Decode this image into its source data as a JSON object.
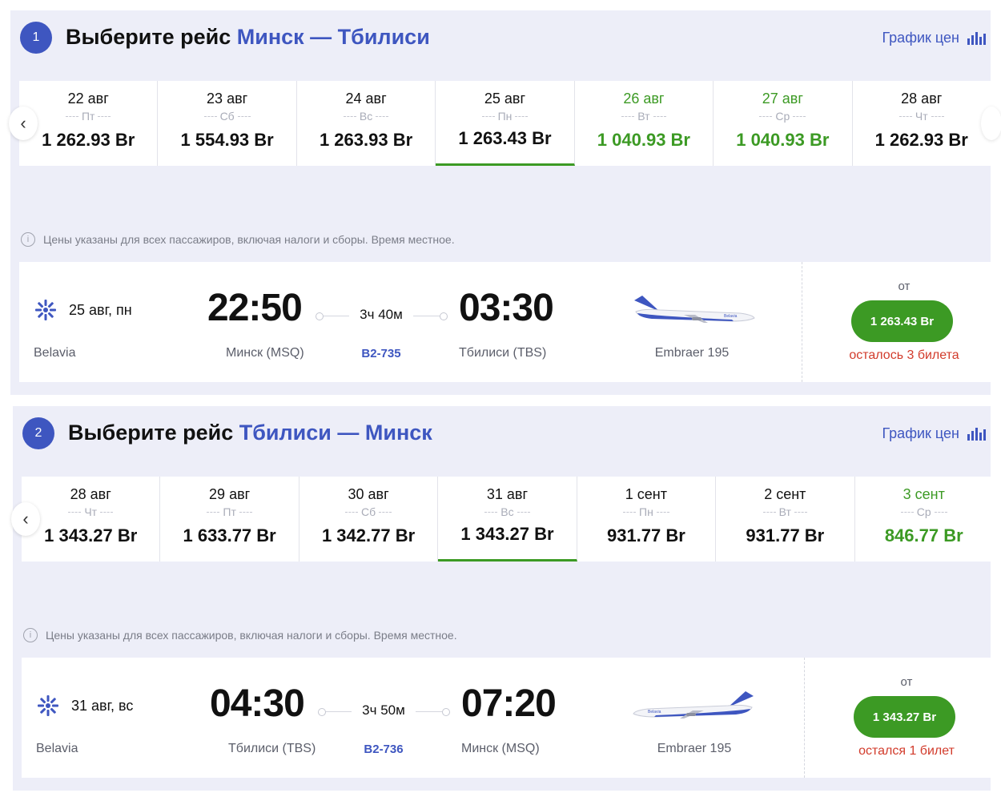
{
  "sections": [
    {
      "step": "1",
      "title_prefix": "Выберите рейс",
      "route": "Минск — Тбилиси",
      "chart_link": "График цен",
      "dates": [
        {
          "date": "22 авг",
          "weekday": "Пт",
          "price": "1 262.93 Br"
        },
        {
          "date": "23 авг",
          "weekday": "Сб",
          "price": "1 554.93 Br"
        },
        {
          "date": "24 авг",
          "weekday": "Вс",
          "price": "1 263.93 Br"
        },
        {
          "date": "25 авг",
          "weekday": "Пн",
          "price": "1 263.43 Br"
        },
        {
          "date": "26 авг",
          "weekday": "Вт",
          "price": "1 040.93 Br"
        },
        {
          "date": "27 авг",
          "weekday": "Ср",
          "price": "1 040.93 Br"
        },
        {
          "date": "28 авг",
          "weekday": "Чт",
          "price": "1 262.93 Br"
        }
      ],
      "note": "Цены указаны для всех пассажиров, включая налоги и сборы. Время местное.",
      "flight": {
        "date": "25 авг, пн",
        "airline": "Belavia",
        "dep_time": "22:50",
        "dep_city": "Минск (MSQ)",
        "duration": "3ч 40м",
        "flight_number": "B2-735",
        "arr_time": "03:30",
        "arr_city": "Тбилиси (TBS)",
        "aircraft": "Embraer 195",
        "aircraft_livery": "Belavia",
        "from_label": "от",
        "price": "1 263.43 Br",
        "seats_left": "осталось 3 билета"
      }
    },
    {
      "step": "2",
      "title_prefix": "Выберите рейс",
      "route": "Тбилиси — Минск",
      "chart_link": "График цен",
      "dates": [
        {
          "date": "28 авг",
          "weekday": "Чт",
          "price": "1 343.27 Br"
        },
        {
          "date": "29 авг",
          "weekday": "Пт",
          "price": "1 633.77 Br"
        },
        {
          "date": "30 авг",
          "weekday": "Сб",
          "price": "1 342.77 Br"
        },
        {
          "date": "31 авг",
          "weekday": "Вс",
          "price": "1 343.27 Br"
        },
        {
          "date": "1 сент",
          "weekday": "Пн",
          "price": "931.77 Br"
        },
        {
          "date": "2 сент",
          "weekday": "Вт",
          "price": "931.77 Br"
        },
        {
          "date": "3 сент",
          "weekday": "Ср",
          "price": "846.77 Br"
        }
      ],
      "note": "Цены указаны для всех пассажиров, включая налоги и сборы. Время местное.",
      "flight": {
        "date": "31 авг, вс",
        "airline": "Belavia",
        "dep_time": "04:30",
        "dep_city": "Тбилиси (TBS)",
        "duration": "3ч 50м",
        "flight_number": "B2-736",
        "arr_time": "07:20",
        "arr_city": "Минск (MSQ)",
        "aircraft": "Embraer 195",
        "aircraft_livery": "Belavia",
        "from_label": "от",
        "price": "1 343.27 Br",
        "seats_left": "остался 1 билет"
      }
    }
  ],
  "icons": {
    "prev": "chevron-left-icon",
    "chart": "bar-chart-icon",
    "info": "info-icon",
    "logo": "belavia-logo-icon",
    "plane": "airplane-image"
  },
  "colors": {
    "accent": "#3e56c0",
    "green": "#3c9a24",
    "warning": "#d23b2b",
    "background": "#edeef8"
  }
}
